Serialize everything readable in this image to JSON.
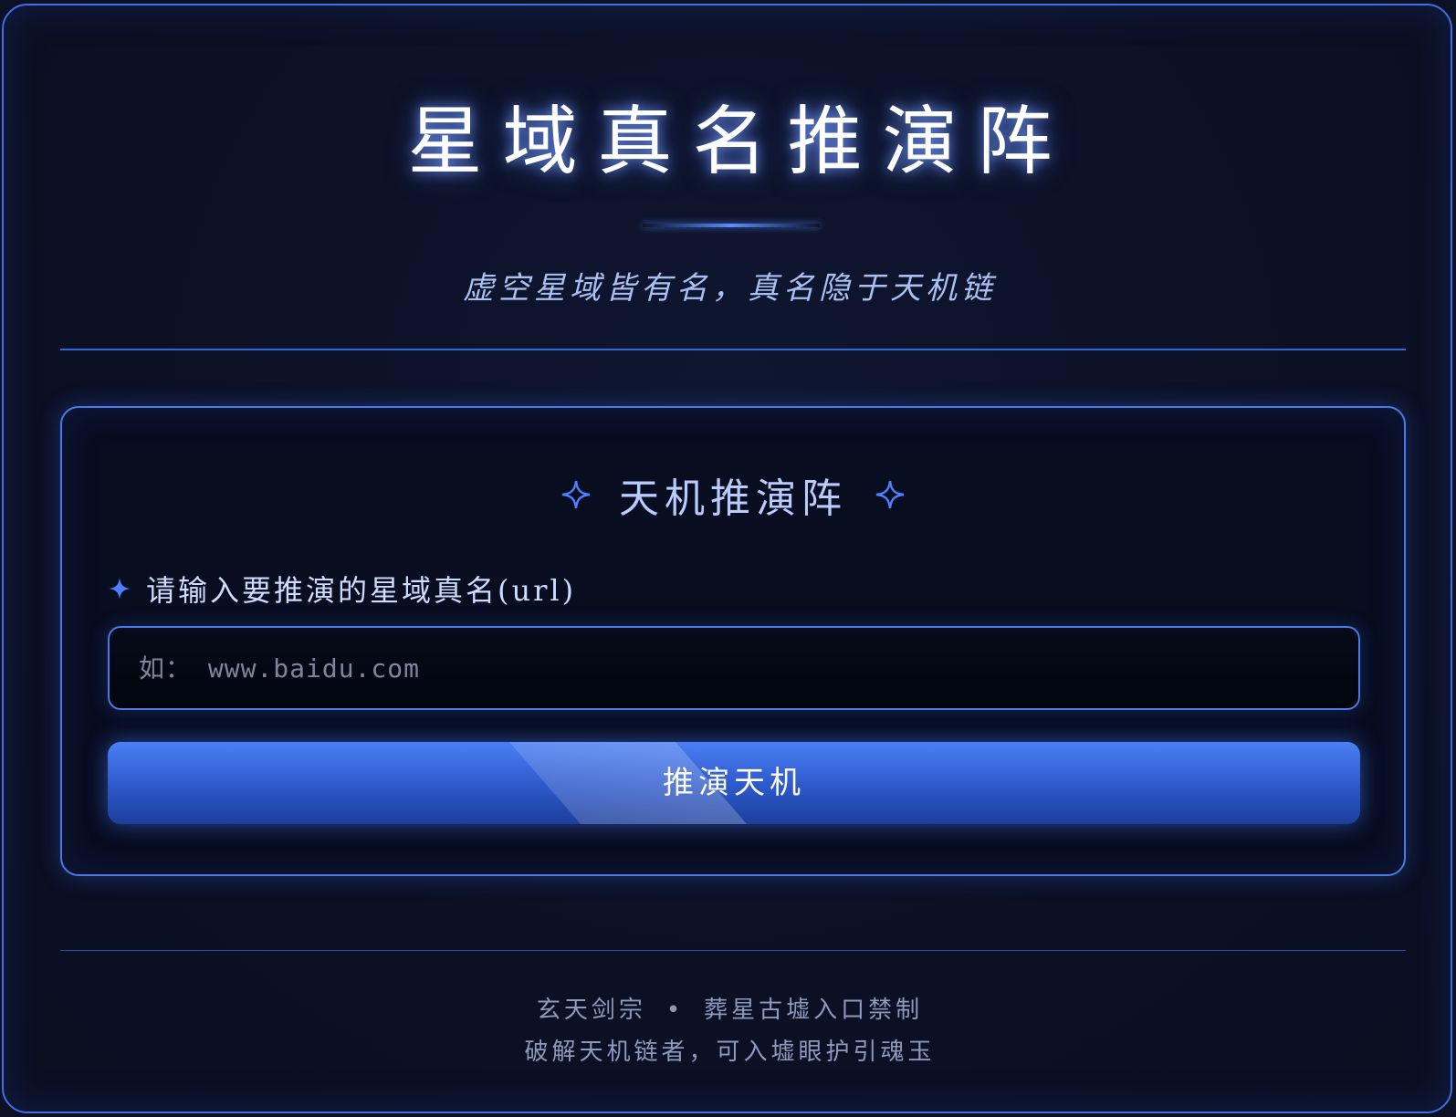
{
  "header": {
    "title": "星域真名推演阵",
    "subtitle": "虚空星域皆有名，真名隐于天机链"
  },
  "card": {
    "title": "天机推演阵",
    "field_label": "请输入要推演的星域真名(url)",
    "input_value": "",
    "input_placeholder": "如： www.baidu.com",
    "button_label": "推演天机"
  },
  "footer": {
    "line1_left": "玄天剑宗",
    "separator": "•",
    "line1_right": "葬星古墟入口禁制",
    "line2": "破解天机链者，可入墟眼护引魂玉"
  },
  "colors": {
    "accent": "#4a7ae8",
    "background": "#0c1126",
    "button": "#2c58c9"
  },
  "icons": {
    "title_left": "four-point-star-outline-icon",
    "title_right": "four-point-star-outline-icon",
    "label": "four-point-star-filled-icon"
  }
}
